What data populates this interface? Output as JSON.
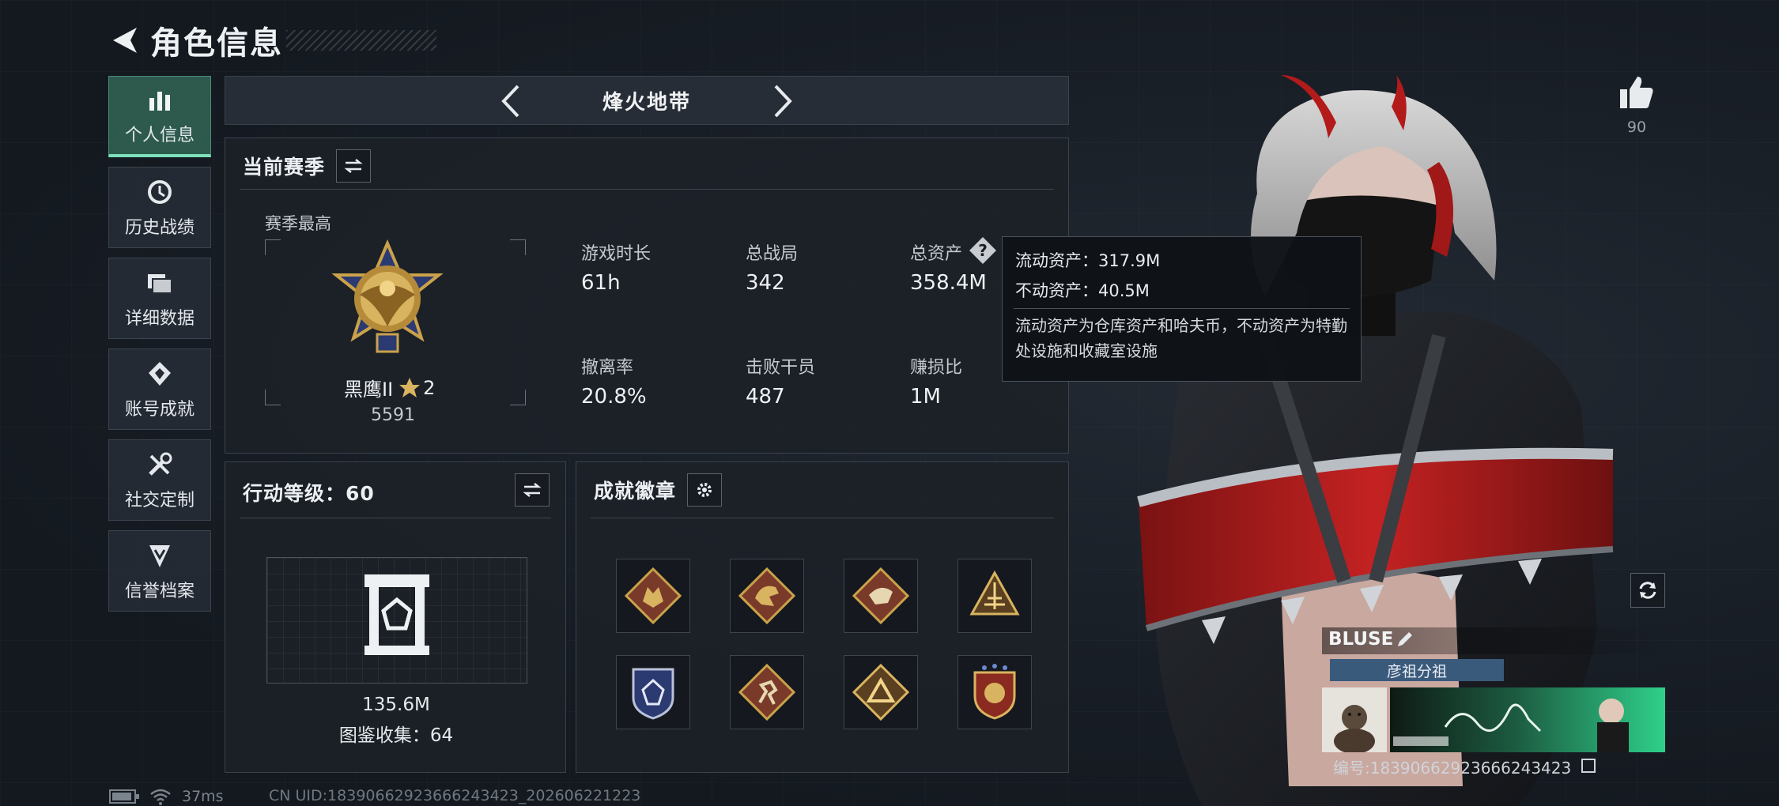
{
  "header": {
    "title": "角色信息"
  },
  "sidebar": {
    "items": [
      {
        "label": "个人信息",
        "icon": "bar-chart-icon",
        "active": true
      },
      {
        "label": "历史战绩",
        "icon": "history-icon",
        "active": false
      },
      {
        "label": "详细数据",
        "icon": "folder-icon",
        "active": false
      },
      {
        "label": "账号成就",
        "icon": "achievement-icon",
        "active": false
      },
      {
        "label": "社交定制",
        "icon": "tools-icon",
        "active": false
      },
      {
        "label": "信誉档案",
        "icon": "shield-rank-icon",
        "active": false
      }
    ]
  },
  "mode": {
    "title": "烽火地带"
  },
  "season": {
    "title": "当前赛季",
    "best_label": "赛季最高",
    "rank_name": "黑鹰II",
    "rank_stars": "2",
    "rank_score": "5591",
    "stats": [
      {
        "label": "游戏时长",
        "value": "61h"
      },
      {
        "label": "总战局",
        "value": "342"
      },
      {
        "label": "总资产",
        "value": "358.4M"
      },
      {
        "label": "撤离率",
        "value": "20.8%"
      },
      {
        "label": "击败干员",
        "value": "487"
      },
      {
        "label": "赚损比",
        "value": "1M"
      }
    ]
  },
  "tooltip": {
    "liquid": "流动资产：317.9M",
    "fixed": "不动资产：40.5M",
    "desc": "流动资产为仓库资产和哈夫币，不动资产为特勤处设施和收藏室设施"
  },
  "action_level": {
    "title": "行动等级：60",
    "value": "135.6M",
    "collection": "图鉴收集：64"
  },
  "achievements": {
    "title": "成就徽章",
    "badges": [
      "wolf-badge-icon",
      "dragon-badge-icon",
      "raptor-badge-icon",
      "pyramid-badge-icon",
      "police-badge-icon",
      "runner-badge-icon",
      "triangle-badge-icon",
      "shield-star-badge-icon"
    ]
  },
  "player": {
    "likes": "90",
    "name": "BLUSE",
    "tag": "彦祖分祖",
    "id_text": "编号:18390662923666243423"
  },
  "status": {
    "ping": "37ms",
    "uid": "CN UID:18390662923666243423_202606221223"
  },
  "colors": {
    "accent": "#7ee0bb",
    "active_bg": "#2d5a4c",
    "gold": "#c9a24a"
  }
}
